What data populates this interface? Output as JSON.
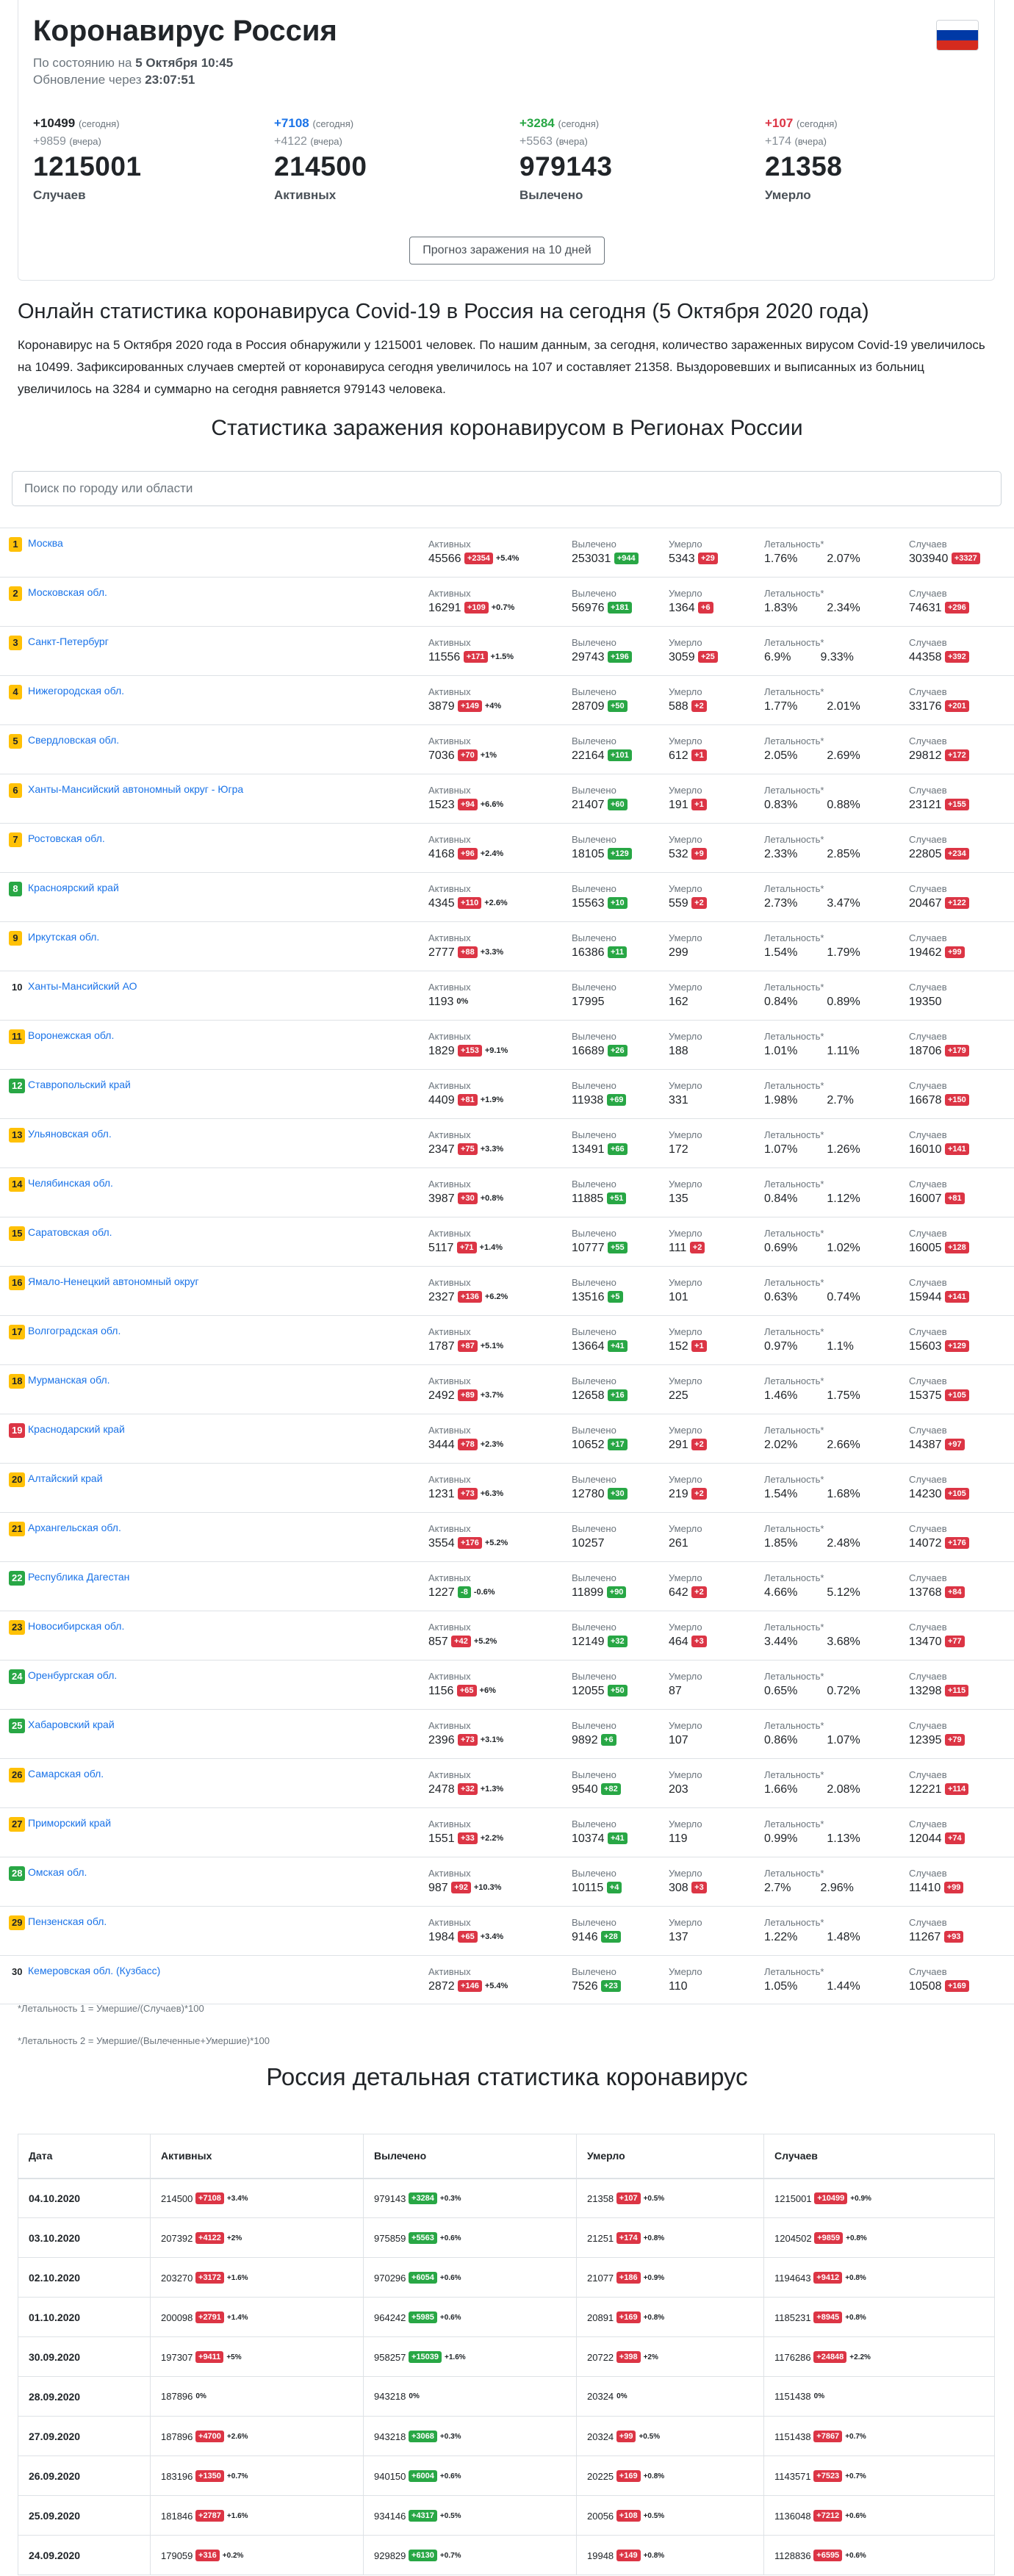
{
  "header": {
    "title": "Коронавирус Россия",
    "asof_prefix": "По состоянию на",
    "asof_value": "5 Октября 10:45",
    "update_prefix": "Обновление через",
    "update_value": "23:07:51",
    "flag_colors": [
      "#ffffff",
      "#0039a6",
      "#d52b1e"
    ]
  },
  "stats": [
    {
      "today": "+10499",
      "today_color": "#212529",
      "today_label": "(сегодня)",
      "yesterday": "+9859",
      "yesterday_label": "(вчера)",
      "total": "1215001",
      "label": "Случаев"
    },
    {
      "today": "+7108",
      "today_color": "#1a73e8",
      "today_label": "(сегодня)",
      "yesterday": "+4122",
      "yesterday_label": "(вчера)",
      "total": "214500",
      "label": "Активных"
    },
    {
      "today": "+3284",
      "today_color": "#28a745",
      "today_label": "(сегодня)",
      "yesterday": "+5563",
      "yesterday_label": "(вчера)",
      "total": "979143",
      "label": "Вылечено"
    },
    {
      "today": "+107",
      "today_color": "#dc3545",
      "today_label": "(сегодня)",
      "yesterday": "+174",
      "yesterday_label": "(вчера)",
      "total": "21358",
      "label": "Умерло"
    }
  ],
  "forecast_button": "Прогноз заражения на 10 дней",
  "online_heading": "Онлайн статистика коронавируса Covid-19 в Россия на сегодня (5 Октября 2020 года)",
  "description": "Коронавирус на 5 Октября 2020 года в Россия обнаружили у 1215001 человек. По нашим данным, за сегодня, количество зараженных вирусом Covid-19 увеличилось на 10499. Зафиксированных случаев смертей от коронавируса сегодня увеличилось на 107 и составляет 21358. Выздоровевших и выписанных из больниц увеличилось на 3284 и суммарно на сегодня равняется 979143 человека.",
  "regions_heading": "Статистика заражения коронавирусом в Регионах России",
  "search": {
    "placeholder": "Поиск по городу или области"
  },
  "region_labels": {
    "active": "Активных",
    "recovered": "Вылечено",
    "died": "Умерло",
    "lethality": "Летальность*",
    "cases": "Случаев"
  },
  "regions": [
    {
      "n": "1",
      "nc": "yellow",
      "name": "Москва",
      "active": "45566",
      "active_d": "+2354",
      "active_dc": "red",
      "active_p": "+5.4%",
      "rec": "253031",
      "rec_d": "+944",
      "died": "5343",
      "died_d": "+29",
      "l1": "1.76%",
      "l2": "2.07%",
      "cases": "303940",
      "cases_d": "+3327"
    },
    {
      "n": "2",
      "nc": "yellow",
      "name": "Московская обл.",
      "active": "16291",
      "active_d": "+109",
      "active_dc": "red",
      "active_p": "+0.7%",
      "rec": "56976",
      "rec_d": "+181",
      "died": "1364",
      "died_d": "+6",
      "l1": "1.83%",
      "l2": "2.34%",
      "cases": "74631",
      "cases_d": "+296"
    },
    {
      "n": "3",
      "nc": "yellow",
      "name": "Санкт-Петербург",
      "active": "11556",
      "active_d": "+171",
      "active_dc": "red",
      "active_p": "+1.5%",
      "rec": "29743",
      "rec_d": "+196",
      "died": "3059",
      "died_d": "+25",
      "l1": "6.9%",
      "l2": "9.33%",
      "cases": "44358",
      "cases_d": "+392"
    },
    {
      "n": "4",
      "nc": "yellow",
      "name": "Нижегородская обл.",
      "active": "3879",
      "active_d": "+149",
      "active_dc": "red",
      "active_p": "+4%",
      "rec": "28709",
      "rec_d": "+50",
      "died": "588",
      "died_d": "+2",
      "l1": "1.77%",
      "l2": "2.01%",
      "cases": "33176",
      "cases_d": "+201"
    },
    {
      "n": "5",
      "nc": "yellow",
      "name": "Свердловская обл.",
      "active": "7036",
      "active_d": "+70",
      "active_dc": "red",
      "active_p": "+1%",
      "rec": "22164",
      "rec_d": "+101",
      "died": "612",
      "died_d": "+1",
      "l1": "2.05%",
      "l2": "2.69%",
      "cases": "29812",
      "cases_d": "+172"
    },
    {
      "n": "6",
      "nc": "yellow",
      "name": "Ханты-Мансийский автономный округ - Югра",
      "active": "1523",
      "active_d": "+94",
      "active_dc": "red",
      "active_p": "+6.6%",
      "rec": "21407",
      "rec_d": "+60",
      "died": "191",
      "died_d": "+1",
      "l1": "0.83%",
      "l2": "0.88%",
      "cases": "23121",
      "cases_d": "+155"
    },
    {
      "n": "7",
      "nc": "yellow",
      "name": "Ростовская обл.",
      "active": "4168",
      "active_d": "+96",
      "active_dc": "red",
      "active_p": "+2.4%",
      "rec": "18105",
      "rec_d": "+129",
      "died": "532",
      "died_d": "+9",
      "l1": "2.33%",
      "l2": "2.85%",
      "cases": "22805",
      "cases_d": "+234"
    },
    {
      "n": "8",
      "nc": "green",
      "name": "Красноярский край",
      "active": "4345",
      "active_d": "+110",
      "active_dc": "red",
      "active_p": "+2.6%",
      "rec": "15563",
      "rec_d": "+10",
      "died": "559",
      "died_d": "+2",
      "l1": "2.73%",
      "l2": "3.47%",
      "cases": "20467",
      "cases_d": "+122"
    },
    {
      "n": "9",
      "nc": "yellow",
      "name": "Иркутская обл.",
      "active": "2777",
      "active_d": "+88",
      "active_dc": "red",
      "active_p": "+3.3%",
      "rec": "16386",
      "rec_d": "+11",
      "died": "299",
      "died_d": "",
      "l1": "1.54%",
      "l2": "1.79%",
      "cases": "19462",
      "cases_d": "+99"
    },
    {
      "n": "10",
      "nc": "plain",
      "name": "Ханты-Мансийский АО",
      "active": "1193",
      "active_d": "",
      "active_dc": "red",
      "active_p": "0%",
      "rec": "17995",
      "rec_d": "",
      "died": "162",
      "died_d": "",
      "l1": "0.84%",
      "l2": "0.89%",
      "cases": "19350",
      "cases_d": ""
    },
    {
      "n": "11",
      "nc": "yellow",
      "name": "Воронежская обл.",
      "active": "1829",
      "active_d": "+153",
      "active_dc": "red",
      "active_p": "+9.1%",
      "rec": "16689",
      "rec_d": "+26",
      "died": "188",
      "died_d": "",
      "l1": "1.01%",
      "l2": "1.11%",
      "cases": "18706",
      "cases_d": "+179"
    },
    {
      "n": "12",
      "nc": "green",
      "name": "Ставропольский край",
      "active": "4409",
      "active_d": "+81",
      "active_dc": "red",
      "active_p": "+1.9%",
      "rec": "11938",
      "rec_d": "+69",
      "died": "331",
      "died_d": "",
      "l1": "1.98%",
      "l2": "2.7%",
      "cases": "16678",
      "cases_d": "+150"
    },
    {
      "n": "13",
      "nc": "yellow",
      "name": "Ульяновская обл.",
      "active": "2347",
      "active_d": "+75",
      "active_dc": "red",
      "active_p": "+3.3%",
      "rec": "13491",
      "rec_d": "+66",
      "died": "172",
      "died_d": "",
      "l1": "1.07%",
      "l2": "1.26%",
      "cases": "16010",
      "cases_d": "+141"
    },
    {
      "n": "14",
      "nc": "yellow",
      "name": "Челябинская обл.",
      "active": "3987",
      "active_d": "+30",
      "active_dc": "red",
      "active_p": "+0.8%",
      "rec": "11885",
      "rec_d": "+51",
      "died": "135",
      "died_d": "",
      "l1": "0.84%",
      "l2": "1.12%",
      "cases": "16007",
      "cases_d": "+81"
    },
    {
      "n": "15",
      "nc": "yellow",
      "name": "Саратовская обл.",
      "active": "5117",
      "active_d": "+71",
      "active_dc": "red",
      "active_p": "+1.4%",
      "rec": "10777",
      "rec_d": "+55",
      "died": "111",
      "died_d": "+2",
      "l1": "0.69%",
      "l2": "1.02%",
      "cases": "16005",
      "cases_d": "+128"
    },
    {
      "n": "16",
      "nc": "yellow",
      "name": "Ямало-Ненецкий автономный округ",
      "active": "2327",
      "active_d": "+136",
      "active_dc": "red",
      "active_p": "+6.2%",
      "rec": "13516",
      "rec_d": "+5",
      "died": "101",
      "died_d": "",
      "l1": "0.63%",
      "l2": "0.74%",
      "cases": "15944",
      "cases_d": "+141"
    },
    {
      "n": "17",
      "nc": "yellow",
      "name": "Волгоградская обл.",
      "active": "1787",
      "active_d": "+87",
      "active_dc": "red",
      "active_p": "+5.1%",
      "rec": "13664",
      "rec_d": "+41",
      "died": "152",
      "died_d": "+1",
      "l1": "0.97%",
      "l2": "1.1%",
      "cases": "15603",
      "cases_d": "+129"
    },
    {
      "n": "18",
      "nc": "yellow",
      "name": "Мурманская обл.",
      "active": "2492",
      "active_d": "+89",
      "active_dc": "red",
      "active_p": "+3.7%",
      "rec": "12658",
      "rec_d": "+16",
      "died": "225",
      "died_d": "",
      "l1": "1.46%",
      "l2": "1.75%",
      "cases": "15375",
      "cases_d": "+105"
    },
    {
      "n": "19",
      "nc": "red",
      "name": "Краснодарский край",
      "active": "3444",
      "active_d": "+78",
      "active_dc": "red",
      "active_p": "+2.3%",
      "rec": "10652",
      "rec_d": "+17",
      "died": "291",
      "died_d": "+2",
      "l1": "2.02%",
      "l2": "2.66%",
      "cases": "14387",
      "cases_d": "+97"
    },
    {
      "n": "20",
      "nc": "yellow",
      "name": "Алтайский край",
      "active": "1231",
      "active_d": "+73",
      "active_dc": "red",
      "active_p": "+6.3%",
      "rec": "12780",
      "rec_d": "+30",
      "died": "219",
      "died_d": "+2",
      "l1": "1.54%",
      "l2": "1.68%",
      "cases": "14230",
      "cases_d": "+105"
    },
    {
      "n": "21",
      "nc": "yellow",
      "name": "Архангельская обл.",
      "active": "3554",
      "active_d": "+176",
      "active_dc": "red",
      "active_p": "+5.2%",
      "rec": "10257",
      "rec_d": "",
      "died": "261",
      "died_d": "",
      "l1": "1.85%",
      "l2": "2.48%",
      "cases": "14072",
      "cases_d": "+176"
    },
    {
      "n": "22",
      "nc": "green",
      "name": "Республика Дагестан",
      "active": "1227",
      "active_d": "-8",
      "active_dc": "green",
      "active_p": "-0.6%",
      "rec": "11899",
      "rec_d": "+90",
      "died": "642",
      "died_d": "+2",
      "l1": "4.66%",
      "l2": "5.12%",
      "cases": "13768",
      "cases_d": "+84"
    },
    {
      "n": "23",
      "nc": "yellow",
      "name": "Новосибирская обл.",
      "active": "857",
      "active_d": "+42",
      "active_dc": "red",
      "active_p": "+5.2%",
      "rec": "12149",
      "rec_d": "+32",
      "died": "464",
      "died_d": "+3",
      "l1": "3.44%",
      "l2": "3.68%",
      "cases": "13470",
      "cases_d": "+77"
    },
    {
      "n": "24",
      "nc": "green",
      "name": "Оренбургская обл.",
      "active": "1156",
      "active_d": "+65",
      "active_dc": "red",
      "active_p": "+6%",
      "rec": "12055",
      "rec_d": "+50",
      "died": "87",
      "died_d": "",
      "l1": "0.65%",
      "l2": "0.72%",
      "cases": "13298",
      "cases_d": "+115"
    },
    {
      "n": "25",
      "nc": "green",
      "name": "Хабаровский край",
      "active": "2396",
      "active_d": "+73",
      "active_dc": "red",
      "active_p": "+3.1%",
      "rec": "9892",
      "rec_d": "+6",
      "died": "107",
      "died_d": "",
      "l1": "0.86%",
      "l2": "1.07%",
      "cases": "12395",
      "cases_d": "+79"
    },
    {
      "n": "26",
      "nc": "yellow",
      "name": "Самарская обл.",
      "active": "2478",
      "active_d": "+32",
      "active_dc": "red",
      "active_p": "+1.3%",
      "rec": "9540",
      "rec_d": "+82",
      "died": "203",
      "died_d": "",
      "l1": "1.66%",
      "l2": "2.08%",
      "cases": "12221",
      "cases_d": "+114"
    },
    {
      "n": "27",
      "nc": "yellow",
      "name": "Приморский край",
      "active": "1551",
      "active_d": "+33",
      "active_dc": "red",
      "active_p": "+2.2%",
      "rec": "10374",
      "rec_d": "+41",
      "died": "119",
      "died_d": "",
      "l1": "0.99%",
      "l2": "1.13%",
      "cases": "12044",
      "cases_d": "+74"
    },
    {
      "n": "28",
      "nc": "green",
      "name": "Омская обл.",
      "active": "987",
      "active_d": "+92",
      "active_dc": "red",
      "active_p": "+10.3%",
      "rec": "10115",
      "rec_d": "+4",
      "died": "308",
      "died_d": "+3",
      "l1": "2.7%",
      "l2": "2.96%",
      "cases": "11410",
      "cases_d": "+99"
    },
    {
      "n": "29",
      "nc": "yellow",
      "name": "Пензенская обл.",
      "active": "1984",
      "active_d": "+65",
      "active_dc": "red",
      "active_p": "+3.4%",
      "rec": "9146",
      "rec_d": "+28",
      "died": "137",
      "died_d": "",
      "l1": "1.22%",
      "l2": "1.48%",
      "cases": "11267",
      "cases_d": "+93"
    },
    {
      "n": "30",
      "nc": "plain",
      "name": "Кемеровская обл. (Кузбасс)",
      "active": "2872",
      "active_d": "+146",
      "active_dc": "red",
      "active_p": "+5.4%",
      "rec": "7526",
      "rec_d": "+23",
      "died": "110",
      "died_d": "",
      "l1": "1.05%",
      "l2": "1.44%",
      "cases": "10508",
      "cases_d": "+169"
    }
  ],
  "notes": {
    "lethality1": "*Летальность 1 = Умершие/(Случаев)*100",
    "lethality2": "*Летальность 2 = Умершие/(Вылеченные+Умершие)*100"
  },
  "detail_heading": "Россия детальная статистика коронавирус",
  "detail_headers": [
    "Дата",
    "Активных",
    "Вылечено",
    "Умерло",
    "Случаев"
  ],
  "detail_rows": [
    {
      "date": "04.10.2020",
      "a": "214500",
      "ad": "+7108",
      "adc": "red",
      "ap": "+3.4%",
      "r": "979143",
      "rd": "+3284",
      "rp": "+0.3%",
      "d": "21358",
      "dd": "+107",
      "dp": "+0.5%",
      "c": "1215001",
      "cd": "+10499",
      "cp": "+0.9%"
    },
    {
      "date": "03.10.2020",
      "a": "207392",
      "ad": "+4122",
      "adc": "red",
      "ap": "+2%",
      "r": "975859",
      "rd": "+5563",
      "rp": "+0.6%",
      "d": "21251",
      "dd": "+174",
      "dp": "+0.8%",
      "c": "1204502",
      "cd": "+9859",
      "cp": "+0.8%"
    },
    {
      "date": "02.10.2020",
      "a": "203270",
      "ad": "+3172",
      "adc": "red",
      "ap": "+1.6%",
      "r": "970296",
      "rd": "+6054",
      "rp": "+0.6%",
      "d": "21077",
      "dd": "+186",
      "dp": "+0.9%",
      "c": "1194643",
      "cd": "+9412",
      "cp": "+0.8%"
    },
    {
      "date": "01.10.2020",
      "a": "200098",
      "ad": "+2791",
      "adc": "red",
      "ap": "+1.4%",
      "r": "964242",
      "rd": "+5985",
      "rp": "+0.6%",
      "d": "20891",
      "dd": "+169",
      "dp": "+0.8%",
      "c": "1185231",
      "cd": "+8945",
      "cp": "+0.8%"
    },
    {
      "date": "30.09.2020",
      "a": "197307",
      "ad": "+9411",
      "adc": "red",
      "ap": "+5%",
      "r": "958257",
      "rd": "+15039",
      "rp": "+1.6%",
      "d": "20722",
      "dd": "+398",
      "dp": "+2%",
      "c": "1176286",
      "cd": "+24848",
      "cp": "+2.2%"
    },
    {
      "date": "28.09.2020",
      "a": "187896",
      "ad": "",
      "adc": "red",
      "ap": "0%",
      "r": "943218",
      "rd": "",
      "rp": "0%",
      "d": "20324",
      "dd": "",
      "dp": "0%",
      "c": "1151438",
      "cd": "",
      "cp": "0%"
    },
    {
      "date": "27.09.2020",
      "a": "187896",
      "ad": "+4700",
      "adc": "red",
      "ap": "+2.6%",
      "r": "943218",
      "rd": "+3068",
      "rp": "+0.3%",
      "d": "20324",
      "dd": "+99",
      "dp": "+0.5%",
      "c": "1151438",
      "cd": "+7867",
      "cp": "+0.7%"
    },
    {
      "date": "26.09.2020",
      "a": "183196",
      "ad": "+1350",
      "adc": "red",
      "ap": "+0.7%",
      "r": "940150",
      "rd": "+6004",
      "rp": "+0.6%",
      "d": "20225",
      "dd": "+169",
      "dp": "+0.8%",
      "c": "1143571",
      "cd": "+7523",
      "cp": "+0.7%"
    },
    {
      "date": "25.09.2020",
      "a": "181846",
      "ad": "+2787",
      "adc": "red",
      "ap": "+1.6%",
      "r": "934146",
      "rd": "+4317",
      "rp": "+0.5%",
      "d": "20056",
      "dd": "+108",
      "dp": "+0.5%",
      "c": "1136048",
      "cd": "+7212",
      "cp": "+0.6%"
    },
    {
      "date": "24.09.2020",
      "a": "179059",
      "ad": "+316",
      "adc": "red",
      "ap": "+0.2%",
      "r": "929829",
      "rd": "+6130",
      "rp": "+0.7%",
      "d": "19948",
      "dd": "+149",
      "dp": "+0.8%",
      "c": "1128836",
      "cd": "+6595",
      "cp": "+0.6%"
    }
  ]
}
